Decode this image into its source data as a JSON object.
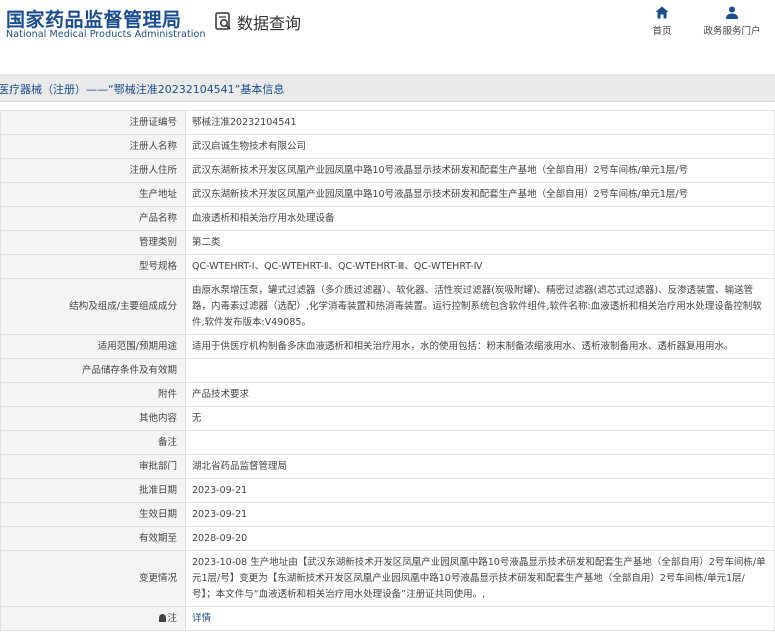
{
  "header": {
    "logo_cn": "国家药品监督管理局",
    "logo_en": "National Medical Products Administration",
    "section_title": "数据查询",
    "nav": [
      {
        "label": "首页",
        "icon": "home-icon"
      },
      {
        "label": "政务服务门户",
        "icon": "user-icon"
      }
    ]
  },
  "title": "医疗器械（注册）——“鄂械注准20232104541”基本信息",
  "rows": [
    {
      "label": "注册证编号",
      "value": "鄂械注准20232104541"
    },
    {
      "label": "注册人名称",
      "value": "武汉启诚生物技术有限公司"
    },
    {
      "label": "注册人住所",
      "value": "武汉东湖新技术开发区凤凰产业园凤凰中路10号液晶显示技术研发和配套生产基地（全部自用）2号车间栋/单元1层/号"
    },
    {
      "label": "生产地址",
      "value": "武汉东湖新技术开发区凤凰产业园凤凰中路10号液晶显示技术研发和配套生产基地（全部自用）2号车间栋/单元1层/号"
    },
    {
      "label": "产品名称",
      "value": "血液透析和相关治疗用水处理设备"
    },
    {
      "label": "管理类别",
      "value": "第二类"
    },
    {
      "label": "型号规格",
      "value": "QC-WTEHRT-Ⅰ、QC-WTEHRT-Ⅱ、QC-WTEHRT-Ⅲ、QC-WTEHRT-Ⅳ"
    },
    {
      "label": "结构及组成/主要组成成分",
      "value": "由原水泵增压泵，罐式过滤器（多介质过滤器）、软化器、活性炭过滤器(炭吸附罐)、精密过滤器(滤芯式过滤器)、反渗透装置、输送管路，内毒素过滤器（选配）,化学消毒装置和热消毒装置。运行控制系统包含软件组件,软件名称:血液透析和相关治疗用水处理设备控制软件,软件发布版本:V49085。"
    },
    {
      "label": "适用范围/预期用途",
      "value": "适用于供医疗机构制备多床血液透析和相关治疗用水，水的使用包括：粉末制备浓缩液用水、透析液制备用水、透析器复用用水。"
    },
    {
      "label": "产品储存条件及有效期",
      "value": ""
    },
    {
      "label": "附件",
      "value": "产品技术要求"
    },
    {
      "label": "其他内容",
      "value": "无"
    },
    {
      "label": "备注",
      "value": ""
    },
    {
      "label": "审批部门",
      "value": "湖北省药品监督管理局"
    },
    {
      "label": "批准日期",
      "value": "2023-09-21"
    },
    {
      "label": "生效日期",
      "value": "2023-09-21"
    },
    {
      "label": "有效期至",
      "value": "2028-09-20"
    },
    {
      "label": "变更情况",
      "value": "2023-10-08 生产地址由【武汉东湖新技术开发区凤凰产业园凤凰中路10号液晶显示技术研发和配套生产基地（全部自用）2号车间栋/单元1层/号】变更为【东湖新技术开发区凤凰产业园凤凰中路10号液晶显示技术研发和配套生产基地（全部自用）2号车间栋/单元1层/号】；本文件与“血液透析和相关治疗用水处理设备”注册证共同使用。,"
    },
    {
      "label": "注",
      "value": "详情"
    }
  ]
}
